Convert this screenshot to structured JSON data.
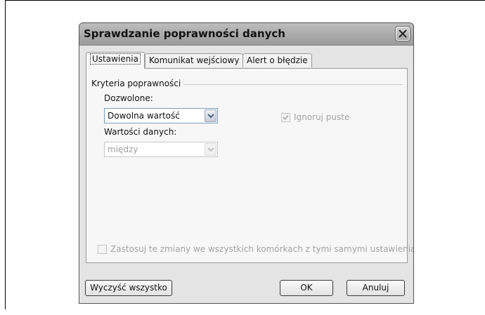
{
  "dialog": {
    "title": "Sprawdzanie poprawności danych",
    "close_icon": "close-icon"
  },
  "tabs": [
    {
      "label": "Ustawienia",
      "active": true
    },
    {
      "label": "Komunikat wejściowy",
      "active": false
    },
    {
      "label": "Alert o błędzie",
      "active": false
    }
  ],
  "settings": {
    "group_label": "Kryteria poprawności",
    "allow_label": "Dozwolone:",
    "allow_value": "Dowolna wartość",
    "data_label": "Wartości danych:",
    "data_value": "między",
    "ignore_blank_label": "Ignoruj puste",
    "ignore_blank_checked": true,
    "apply_all_label": "Zastosuj te zmiany we wszystkich komórkach z tymi samymi ustawieniami",
    "apply_all_checked": false
  },
  "buttons": {
    "clear_all": "Wyczyść wszystko",
    "ok": "OK",
    "cancel": "Anuluj"
  }
}
